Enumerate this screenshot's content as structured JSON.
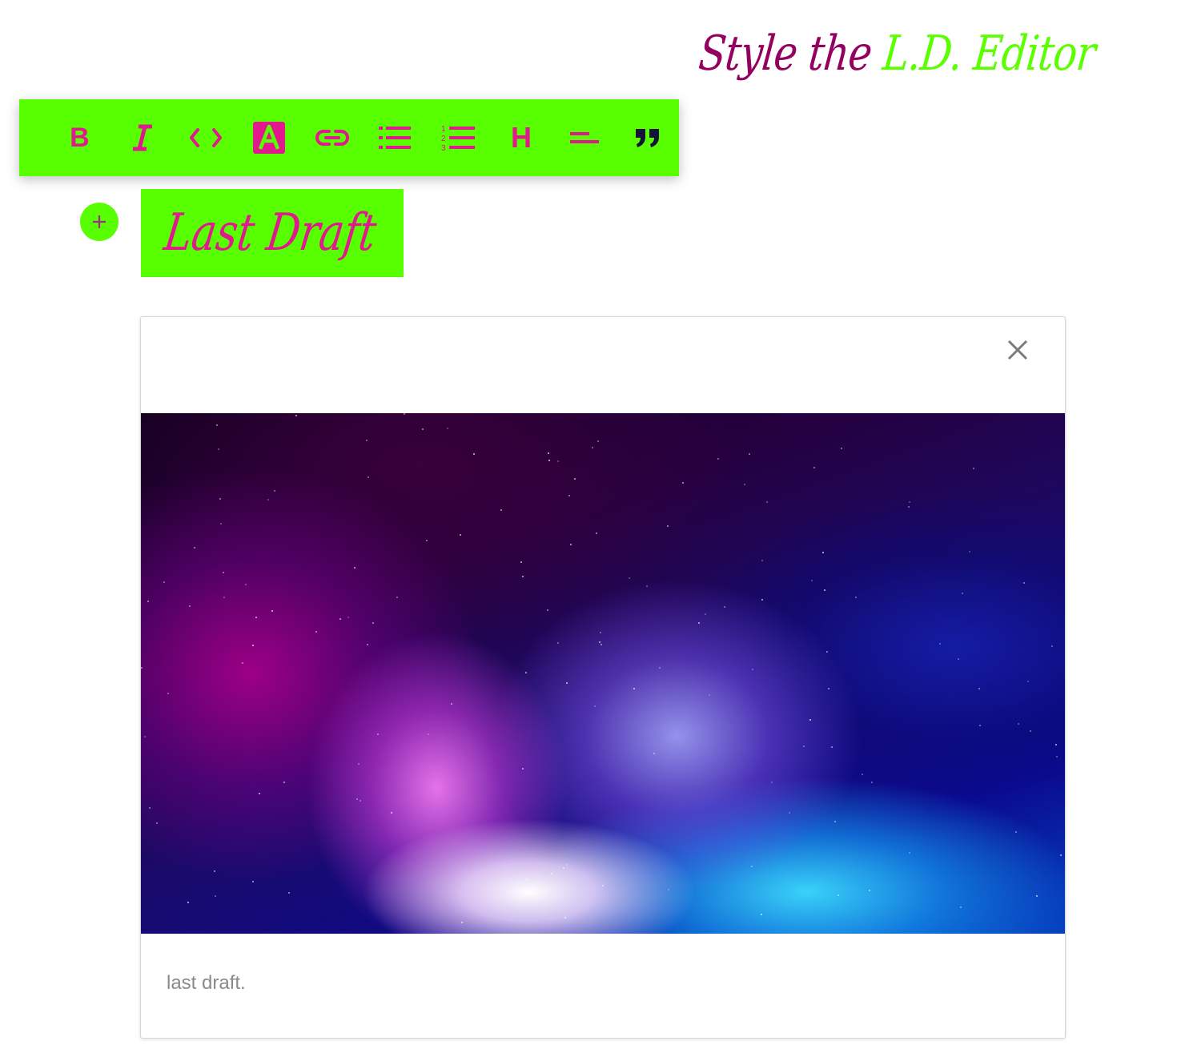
{
  "header": {
    "title_part1": "Style the ",
    "title_part2": "L.D. Editor"
  },
  "toolbar": {
    "buttons": [
      {
        "name": "bold",
        "label": "B"
      },
      {
        "name": "italic",
        "label": "I"
      },
      {
        "name": "code",
        "label": "<>"
      },
      {
        "name": "highlight",
        "label": "A"
      },
      {
        "name": "link",
        "label": ""
      },
      {
        "name": "unordered-list",
        "label": ""
      },
      {
        "name": "ordered-list",
        "label": ""
      },
      {
        "name": "heading",
        "label": "H"
      },
      {
        "name": "align",
        "label": ""
      },
      {
        "name": "blockquote",
        "label": ""
      }
    ]
  },
  "editor": {
    "heading": "Last Draft"
  },
  "image_card": {
    "caption": "last draft."
  },
  "colors": {
    "toolbar_bg": "#58ff00",
    "icon": "#e0198f",
    "title_purple": "#94005f",
    "title_green": "#5bff00"
  }
}
